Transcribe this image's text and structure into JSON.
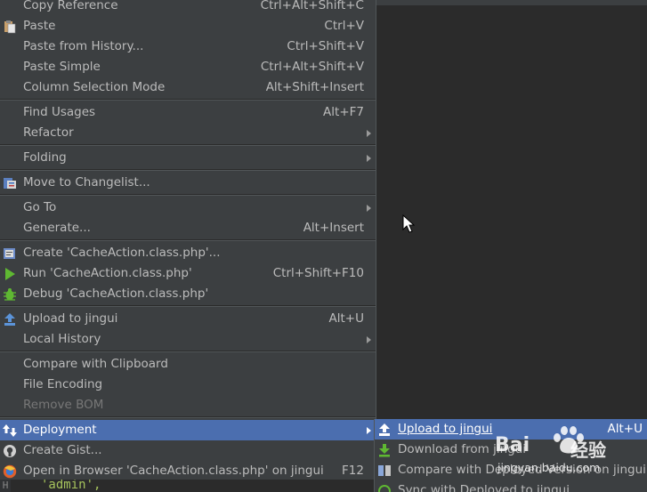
{
  "menu": {
    "items": [
      {
        "label": "Copy Reference",
        "shortcut": "Ctrl+Alt+Shift+C"
      },
      {
        "label": "Paste",
        "shortcut": "Ctrl+V",
        "icon": "paste-icon"
      },
      {
        "label": "Paste from History...",
        "shortcut": "Ctrl+Shift+V"
      },
      {
        "label": "Paste Simple",
        "shortcut": "Ctrl+Alt+Shift+V"
      },
      {
        "label": "Column Selection Mode",
        "shortcut": "Alt+Shift+Insert"
      },
      {
        "label": "Find Usages",
        "shortcut": "Alt+F7"
      },
      {
        "label": "Refactor"
      },
      {
        "label": "Folding"
      },
      {
        "label": "Move to Changelist...",
        "icon": "changelist-icon"
      },
      {
        "label": "Go To"
      },
      {
        "label": "Generate...",
        "shortcut": "Alt+Insert"
      },
      {
        "label": "Create 'CacheAction.class.php'...",
        "icon": "create-config-icon"
      },
      {
        "label": "Run 'CacheAction.class.php'",
        "shortcut": "Ctrl+Shift+F10",
        "icon": "run-icon"
      },
      {
        "label": "Debug 'CacheAction.class.php'",
        "icon": "debug-icon"
      },
      {
        "label": "Upload to jingui",
        "shortcut": "Alt+U",
        "icon": "upload-icon"
      },
      {
        "label": "Local History"
      },
      {
        "label": "Compare with Clipboard"
      },
      {
        "label": "File Encoding"
      },
      {
        "label": "Remove BOM"
      },
      {
        "label": "Deployment",
        "icon": "deployment-icon"
      },
      {
        "label": "Create Gist...",
        "icon": "github-icon"
      },
      {
        "label": "Open in Browser 'CacheAction.class.php' on jingui",
        "shortcut": "F12",
        "icon": "browser-icon"
      }
    ]
  },
  "submenu": {
    "items": [
      {
        "label": "Upload to jingui",
        "shortcut": "Alt+U"
      },
      {
        "label": "Download from jingui"
      },
      {
        "label": "Compare with Deployed Version on jingui"
      },
      {
        "label": "Sync with Deployed to jingui"
      }
    ]
  },
  "editor": {
    "code_text": "'admin',"
  },
  "watermark": {
    "brand": "Bai",
    "brand_cn": "经验",
    "url": "jingyan.baidu.com"
  }
}
